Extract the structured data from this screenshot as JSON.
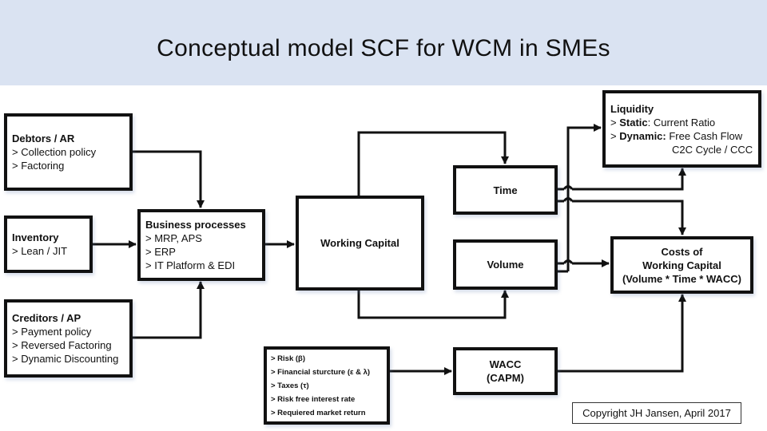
{
  "title": "Conceptual model SCF for WCM in SMEs",
  "colors": {
    "header_bg": "#dae3f2",
    "line": "#111111"
  },
  "boxes": {
    "debtors": {
      "heading": "Debtors / AR",
      "items": [
        "> Collection policy",
        "> Factoring"
      ]
    },
    "inventory": {
      "heading": "Inventory",
      "items": [
        "> Lean / JIT"
      ]
    },
    "creditors": {
      "heading": "Creditors / AP",
      "items": [
        "> Payment policy",
        "> Reversed Factoring",
        "> Dynamic Discounting"
      ]
    },
    "business": {
      "heading": "Business processes",
      "items": [
        "> MRP, APS",
        "> ERP",
        "> IT Platform & EDI"
      ]
    },
    "working_capital": {
      "label": "Working Capital"
    },
    "time": {
      "label": "Time"
    },
    "volume": {
      "label": "Volume"
    },
    "liquidity": {
      "heading": "Liquidity",
      "static_prefix": "> ",
      "static_label": "Static",
      "static_value": ": Current Ratio",
      "dynamic_prefix": "> ",
      "dynamic_label": "Dynamic:",
      "dynamic_value": " Free Cash Flow",
      "dynamic_value2": "C2C Cycle / CCC"
    },
    "costs": {
      "lines": [
        "Costs of",
        "Working Capital",
        "(Volume * Time * WACC)"
      ]
    },
    "wacc": {
      "lines": [
        "WACC",
        "(CAPM)"
      ]
    },
    "risk_factors": {
      "items": [
        "> Risk (β)",
        "> Financial sturcture (ε & λ)",
        "> Taxes (τ)",
        "> Risk free interest rate",
        "> Requiered market return"
      ]
    }
  },
  "copyright": "Copyright JH Jansen, April 2017"
}
